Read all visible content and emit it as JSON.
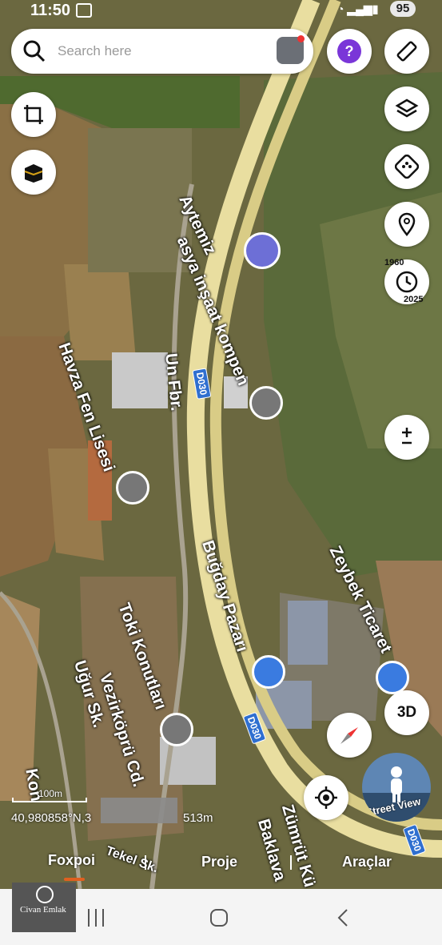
{
  "status": {
    "time": "11:50",
    "battery": "95"
  },
  "search": {
    "placeholder": "Search here"
  },
  "buttons": {
    "three_d": "3D",
    "street_view": "Street View"
  },
  "timeline": {
    "start": "1960",
    "end": "2025"
  },
  "labels": {
    "aytemiz": "Aytemiz",
    "asya": "asya inşaat kompen",
    "havza": "Havza Fen Lisesi",
    "un_fbr": "Un Fbr.",
    "bugday": "Buğday Pazarı",
    "zeybek": "Zeybek Ticaret",
    "toki": "Toki Konutları",
    "ugur": "Uğur Sk.",
    "vezir": "Vezirköprü Cd.",
    "kon": "Kon",
    "tekel": "Tekel Sk.",
    "zumrut": "Zümrüt Kü",
    "baklava": "Baklava",
    "d030": "D030"
  },
  "scale": {
    "label": "100m",
    "coords": "40,980858°N,3",
    "distance": "513m"
  },
  "tabs": {
    "foxpoi": "Foxpoi",
    "proje": "Proje",
    "araclar": "Araçlar"
  },
  "watermark": {
    "name": "Civan Emlak"
  },
  "colors": {
    "road": "#e9dea0",
    "accent": "#2f6fd0"
  }
}
